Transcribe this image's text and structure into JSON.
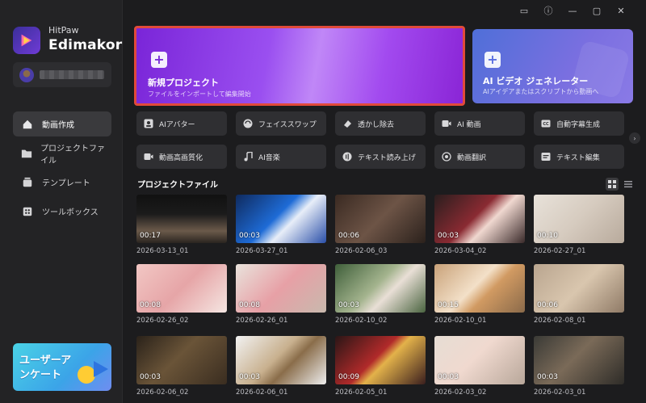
{
  "brand": {
    "line1": "HitPaw",
    "line2": "Edimakor"
  },
  "sidebar": {
    "items": [
      {
        "label": "動画作成",
        "icon": "home-icon",
        "active": true
      },
      {
        "label": "プロジェクトファイル",
        "icon": "folder-icon",
        "active": false
      },
      {
        "label": "テンプレート",
        "icon": "template-icon",
        "active": false
      },
      {
        "label": "ツールボックス",
        "icon": "toolbox-icon",
        "active": false
      }
    ],
    "promo": {
      "line1": "ユーザーア",
      "line2": "ンケート"
    }
  },
  "window_controls": [
    "feedback-icon",
    "info-icon",
    "minimize-icon",
    "maximize-icon",
    "close-icon"
  ],
  "hero": {
    "new_project": {
      "title": "新規プロジェクト",
      "subtitle": "ファイルをインポートして編集開始"
    },
    "ai_video": {
      "title": "AI ビデオ ジェネレーター",
      "subtitle": "AIアイデアまたはスクリプトから動画へ"
    }
  },
  "tools": [
    {
      "label": "AIアバター",
      "icon": "avatar-icon"
    },
    {
      "label": "フェイススワップ",
      "icon": "faceswap-icon"
    },
    {
      "label": "透かし除去",
      "icon": "eraser-icon"
    },
    {
      "label": "AI 動画",
      "icon": "ai-video-icon"
    },
    {
      "label": "自動字幕生成",
      "icon": "cc-icon"
    },
    {
      "label": "動画高画質化",
      "icon": "enhance-icon"
    },
    {
      "label": "AI音楽",
      "icon": "music-icon"
    },
    {
      "label": "テキスト読み上げ",
      "icon": "tts-icon"
    },
    {
      "label": "動画翻訳",
      "icon": "translate-icon"
    },
    {
      "label": "テキスト編集",
      "icon": "text-edit-icon"
    }
  ],
  "projects_section": {
    "title": "プロジェクトファイル"
  },
  "projects": [
    {
      "name": "2026-03-13_01",
      "duration": "00:17",
      "bg": "linear-gradient(180deg,#111 0%,#1b1b1b 40%,#6b5a4a 75%,#2a2420 100%)"
    },
    {
      "name": "2026-03-27_01",
      "duration": "00:03",
      "bg": "linear-gradient(135deg,#0f2a5e 0%,#1e6bd6 45%,#e8eef8 60%,#2a4fa8 100%)"
    },
    {
      "name": "2026-02-06_03",
      "duration": "00:06",
      "bg": "linear-gradient(135deg,#3a2a22 0%,#6d5446 50%,#2b211c 100%)"
    },
    {
      "name": "2026-03-04_02",
      "duration": "00:03",
      "bg": "linear-gradient(135deg,#2a1e1e 0%,#8a2a32 45%,#f0d8d0 60%,#3a2a2a 100%)"
    },
    {
      "name": "2026-02-27_01",
      "duration": "00:10",
      "bg": "linear-gradient(135deg,#e8e2da 0%,#d6cbbf 50%,#b8aa9c 100%)"
    },
    {
      "name": "2026-02-26_02",
      "duration": "00:08",
      "bg": "linear-gradient(135deg,#f2c7c4 0%,#e6a5a7 50%,#f5e6e2 100%)"
    },
    {
      "name": "2026-02-26_01",
      "duration": "00:08",
      "bg": "linear-gradient(135deg,#e9e3dc 0%,#e7a0a6 50%,#c8b9ad 100%)"
    },
    {
      "name": "2026-02-10_02",
      "duration": "00:03",
      "bg": "linear-gradient(135deg,#3f5f3a 0%,#a4b48e 45%,#e9dfd6 60%,#4a6440 100%)"
    },
    {
      "name": "2026-02-10_01",
      "duration": "00:15",
      "bg": "linear-gradient(135deg,#c9a27a 0%,#f3e0c8 45%,#d19a62 60%,#8a6a4a 100%)"
    },
    {
      "name": "2026-02-08_01",
      "duration": "00:06",
      "bg": "linear-gradient(135deg,#b9a58f 0%,#d9c6ae 50%,#8f7a66 100%)"
    },
    {
      "name": "2026-02-06_02",
      "duration": "00:03",
      "bg": "linear-gradient(135deg,#2a221a 0%,#6a5438 45%,#3a2d20 100%)"
    },
    {
      "name": "2026-02-06_01",
      "duration": "00:03",
      "bg": "linear-gradient(135deg,#f2f2f2 0%,#c8b08e 45%,#8a6d4a 60%,#eeeeee 100%)"
    },
    {
      "name": "2026-02-05_01",
      "duration": "00:09",
      "bg": "linear-gradient(135deg,#2a1616 0%,#b12a2a 45%,#e3b24a 55%,#3a1e1e 100%)"
    },
    {
      "name": "2026-02-03_02",
      "duration": "00:03",
      "bg": "linear-gradient(135deg,#e6ddd4 0%,#f0d9cf 45%,#b8a79a 100%)"
    },
    {
      "name": "2026-02-03_01",
      "duration": "00:03",
      "bg": "linear-gradient(135deg,#3a3a36 0%,#7a6a58 45%,#2e2c28 100%)"
    }
  ]
}
